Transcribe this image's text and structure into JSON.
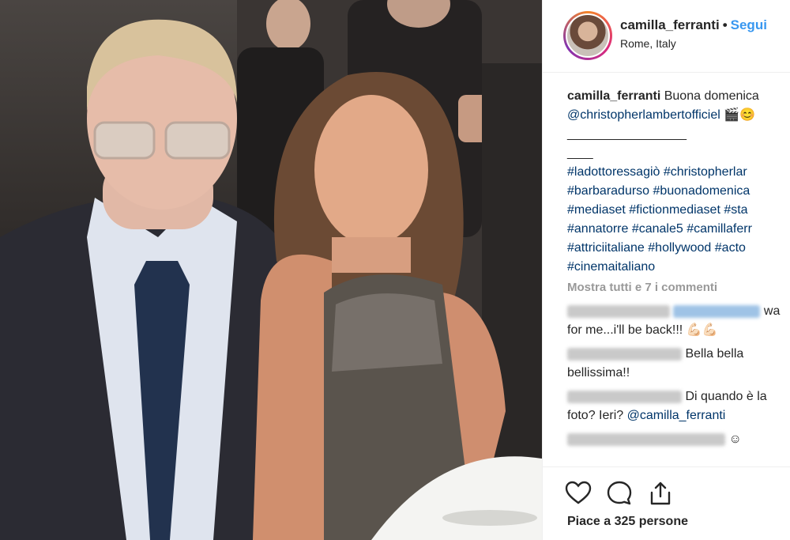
{
  "post": {
    "username": "camilla_ferranti",
    "separator": "•",
    "follow_label": "Segui",
    "location": "Rome, Italy"
  },
  "caption": {
    "user": "camilla_ferranti",
    "text": "Buona domenica",
    "mention": "@christopherlambertofficiel",
    "emoji": "🎬😊",
    "divider": "___________________",
    "divider2": "____",
    "tags": [
      "#ladottoressagiò #christopherlar",
      "#barbaradurso #buonadomenica",
      "#mediaset #fictionmediaset #sta",
      "#annatorre #canale5 #camillaferr",
      "#attriciitaliane #hollywood #acto",
      "#cinemaitaliano"
    ]
  },
  "comments": {
    "show_all": "Mostra tutti e 7 i commenti",
    "items": [
      {
        "text_a": "wa",
        "text_b": "for me...i'll be back!!!",
        "emoji": "💪🏻💪🏻"
      },
      {
        "text_a": "Bella bella",
        "text_b": "bellissima!!"
      },
      {
        "text_a": "Di quando è la",
        "text_b": "foto? Ieri?",
        "mention": "@camilla_ferranti"
      },
      {
        "emoji": "☺"
      }
    ]
  },
  "actions": {
    "likes": "Piace a 325 persone",
    "icons": [
      "heart-icon",
      "comment-icon",
      "share-icon"
    ]
  },
  "colors": {
    "link": "#003569",
    "follow": "#3897f0",
    "muted": "#999999"
  }
}
